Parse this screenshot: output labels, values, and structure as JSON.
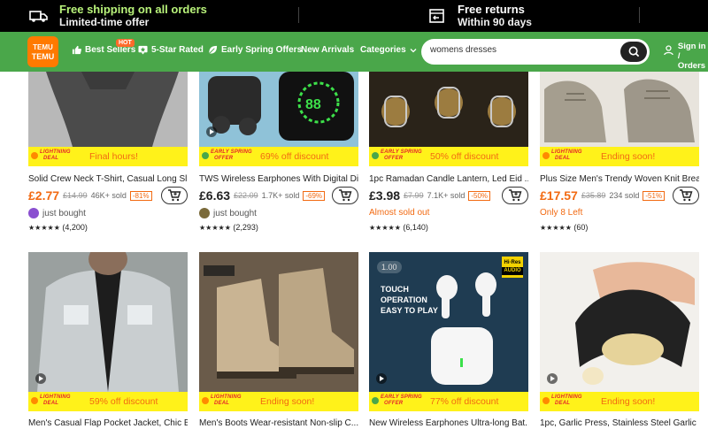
{
  "promo": {
    "shipping_line1": "Free shipping on all orders",
    "shipping_line2": "Limited-time offer",
    "returns_line1": "Free returns",
    "returns_line2": "Within 90 days"
  },
  "nav": {
    "logo_line1": "TEMU",
    "logo_line2": "TEMU",
    "best_sellers": "Best Sellers",
    "hot": "HOT",
    "five_star": "5-Star Rated",
    "spring": "Early Spring Offers",
    "new_arrivals": "New Arrivals",
    "categories": "Categories",
    "search_value": "womens dresses",
    "sign_in": "Sign in /",
    "orders": "Orders &"
  },
  "deal_tags": {
    "lightning_l1": "LIGHTNING",
    "lightning_l2": "DEAL",
    "spring_l1": "EARLY SPRING",
    "spring_l2": "OFFER"
  },
  "products": [
    {
      "deal_type": "lightning",
      "deal_text": "Final hours!",
      "title": "Solid Crew Neck T-Shirt, Casual Long Sl...",
      "price": "£2.77",
      "was": "£14.99",
      "sold": "46K+ sold",
      "off": "-81%",
      "sub": "just bought",
      "rating": "★★★★★",
      "reviews": "(4,200)"
    },
    {
      "deal_type": "spring",
      "deal_text": "69% off discount",
      "title": "TWS Wireless Earphones With Digital Di...",
      "price": "£6.63",
      "was": "£22.09",
      "sold": "1.7K+ sold",
      "off": "-69%",
      "sub": "just bought",
      "rating": "★★★★★",
      "reviews": "(2,293)"
    },
    {
      "deal_type": "spring",
      "deal_text": "50% off discount",
      "title": "1pc Ramadan Candle Lantern, Led Eid ...",
      "price": "£3.98",
      "was": "£7.99",
      "sold": "7.1K+ sold",
      "off": "-50%",
      "sub": "Almost sold out",
      "rating": "★★★★★",
      "reviews": "(6,140)"
    },
    {
      "deal_type": "lightning",
      "deal_text": "Ending soon!",
      "title": "Plus Size Men's Trendy Woven Knit Brea...",
      "price": "£17.57",
      "was": "£35.89",
      "sold": "234 sold",
      "off": "-51%",
      "sub": "Only 8 Left",
      "rating": "★★★★★",
      "reviews": "(60)"
    },
    {
      "deal_type": "lightning",
      "deal_text": "59% off discount",
      "title": "Men's Casual Flap Pocket Jacket, Chic B..."
    },
    {
      "deal_type": "lightning",
      "deal_text": "Ending soon!",
      "title": "Men's Boots Wear-resistant Non-slip C..."
    },
    {
      "deal_type": "spring",
      "deal_text": "77% off discount",
      "title": "New Wireless Earphones Ultra-long Bat..."
    },
    {
      "deal_type": "lightning",
      "deal_text": "Ending soon!",
      "title": "1pc, Garlic Press, Stainless Steel Garlic P..."
    }
  ],
  "image_text": {
    "timer": "1.00",
    "hires_line1": "Hi·Res",
    "hires_line2": "AUDIO",
    "touch_line1": "TOUCH",
    "touch_line2": "OPERATION",
    "touch_line3": "EASY TO PLAY"
  },
  "colors": {
    "nav_green": "#4aa74a",
    "accent_orange": "#f26a12",
    "deal_yellow": "#fff21a",
    "promo_green": "#b8f27a"
  }
}
